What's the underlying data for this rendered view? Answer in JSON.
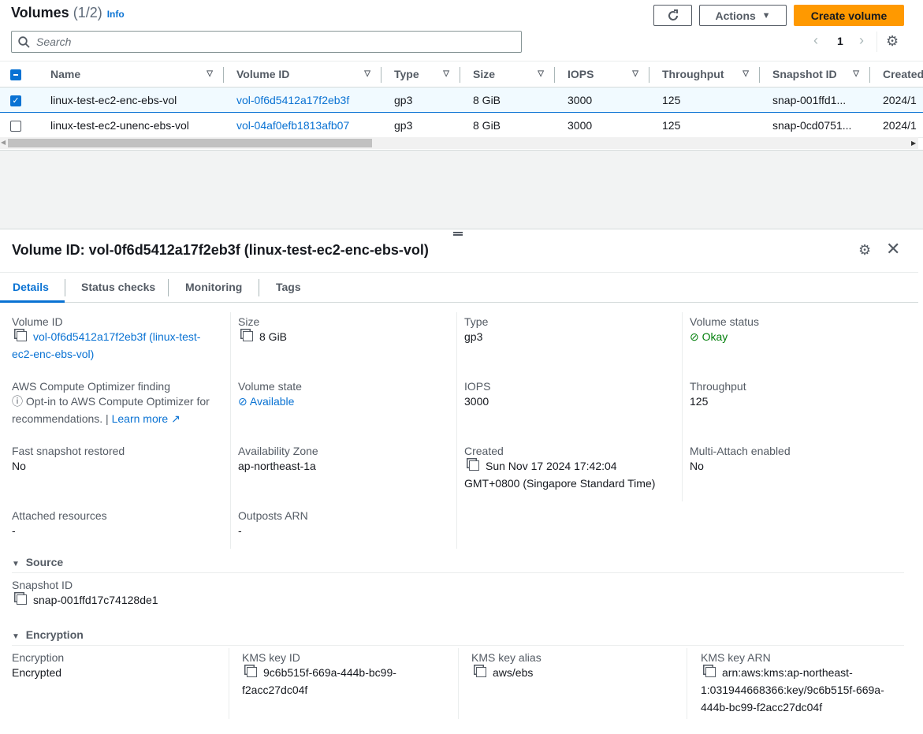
{
  "header": {
    "title": "Volumes",
    "count": "(1/2)",
    "info": "Info",
    "actions": "Actions",
    "create": "Create volume",
    "search_placeholder": "Search",
    "page": "1"
  },
  "table": {
    "columns": [
      "Name",
      "Volume ID",
      "Type",
      "Size",
      "IOPS",
      "Throughput",
      "Snapshot ID",
      "Created"
    ],
    "rows": [
      {
        "selected": true,
        "name": "linux-test-ec2-enc-ebs-vol",
        "id": "vol-0f6d5412a17f2eb3f",
        "type": "gp3",
        "size": "8 GiB",
        "iops": "3000",
        "throughput": "125",
        "snapshot": "snap-001ffd1...",
        "created": "2024/1"
      },
      {
        "selected": false,
        "name": "linux-test-ec2-unenc-ebs-vol",
        "id": "vol-04af0efb1813afb07",
        "type": "gp3",
        "size": "8 GiB",
        "iops": "3000",
        "throughput": "125",
        "snapshot": "snap-0cd0751...",
        "created": "2024/1"
      }
    ]
  },
  "detail": {
    "title": "Volume ID: vol-0f6d5412a17f2eb3f (linux-test-ec2-enc-ebs-vol)",
    "tabs": [
      "Details",
      "Status checks",
      "Monitoring",
      "Tags"
    ],
    "volume_id_label": "Volume ID",
    "volume_id_1": "vol-0f6d5412a17f2eb3f (linux-test-",
    "volume_id_2": "ec2-enc-ebs-vol)",
    "size_label": "Size",
    "size": "8 GiB",
    "type_label": "Type",
    "type": "gp3",
    "status_label": "Volume status",
    "status": "Okay",
    "optimizer_label": "AWS Compute Optimizer finding",
    "optimizer_1": "Opt-in to AWS Compute Optimizer for",
    "optimizer_2": "recommendations. |",
    "learn_more": "Learn more",
    "state_label": "Volume state",
    "state": "Available",
    "iops_label": "IOPS",
    "iops": "3000",
    "throughput_label": "Throughput",
    "throughput": "125",
    "fsr_label": "Fast snapshot restored",
    "fsr": "No",
    "az_label": "Availability Zone",
    "az": "ap-northeast-1a",
    "created_label": "Created",
    "created_1": "Sun Nov 17 2024 17:42:04",
    "created_2": "GMT+0800 (Singapore Standard Time)",
    "multi_label": "Multi-Attach enabled",
    "multi": "No",
    "attached_label": "Attached resources",
    "attached": "-",
    "outposts_label": "Outposts ARN",
    "outposts": "-",
    "source_header": "Source",
    "snapshot_label": "Snapshot ID",
    "snapshot": "snap-001ffd17c74128de1",
    "enc_header": "Encryption",
    "enc_label": "Encryption",
    "enc": "Encrypted",
    "kms_id_label": "KMS key ID",
    "kms_id_1": "9c6b515f-669a-444b-bc99-",
    "kms_id_2": "f2acc27dc04f",
    "kms_alias_label": "KMS key alias",
    "kms_alias": "aws/ebs",
    "kms_arn_label": "KMS key ARN",
    "kms_arn_1": "arn:aws:kms:ap-northeast-",
    "kms_arn_2": "1:031944668366:key/9c6b515f-669a-",
    "kms_arn_3": "444b-bc99-f2acc27dc04f"
  }
}
